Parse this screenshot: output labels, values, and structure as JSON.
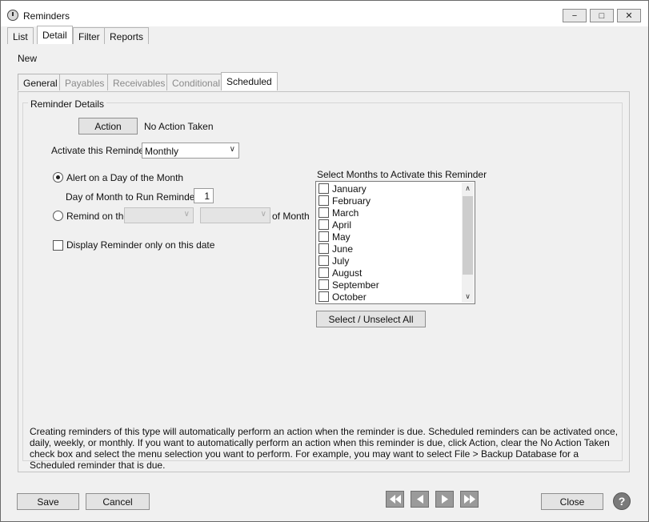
{
  "window": {
    "title": "Reminders",
    "controls": [
      "minimize-icon",
      "maximize-icon",
      "close-icon"
    ]
  },
  "main_tabs": [
    {
      "label": "List"
    },
    {
      "label": "Detail",
      "active": true
    },
    {
      "label": "Filter"
    },
    {
      "label": "Reports"
    }
  ],
  "mode_label": "New",
  "sub_tabs": [
    {
      "label": "General",
      "enabled": true
    },
    {
      "label": "Payables",
      "enabled": false
    },
    {
      "label": "Receivables",
      "enabled": false
    },
    {
      "label": "Conditional",
      "enabled": false
    },
    {
      "label": "Scheduled",
      "enabled": true,
      "active": true
    }
  ],
  "details": {
    "group_label": "Reminder Details",
    "action_button": "Action",
    "action_status": "No Action Taken",
    "activate_label": "Activate this Reminder",
    "activate_value": "Monthly",
    "alert_day_label": "Alert on a Day of the Month",
    "alert_day_selected": true,
    "day_label": "Day of Month to Run Reminder",
    "day_value": "1",
    "remind_on_label": "Remind on the",
    "remind_on_selected": false,
    "of_month_label": "of Month",
    "display_only_label": "Display Reminder only on this date",
    "display_only_checked": false
  },
  "months": {
    "label": "Select Months to Activate this Reminder",
    "items": [
      {
        "label": "January",
        "checked": false
      },
      {
        "label": "February",
        "checked": false
      },
      {
        "label": "March",
        "checked": false
      },
      {
        "label": "April",
        "checked": false
      },
      {
        "label": "May",
        "checked": false
      },
      {
        "label": "June",
        "checked": false
      },
      {
        "label": "July",
        "checked": false
      },
      {
        "label": "August",
        "checked": false
      },
      {
        "label": "September",
        "checked": false
      },
      {
        "label": "October",
        "checked": false
      }
    ],
    "select_all_button": "Select / Unselect All"
  },
  "description": "Creating reminders of this type will automatically perform an action when the reminder is due. Scheduled reminders can be activated once, daily, weekly, or monthly. If you want to automatically perform an action when this reminder is due, click Action, clear the No Action Taken check box and select the menu selection you want to perform. For example, you may want to select File > Backup Database for a Scheduled reminder that is due.",
  "footer": {
    "save": "Save",
    "cancel": "Cancel",
    "close": "Close",
    "help": "?",
    "nav_icons": [
      "first-record-icon",
      "previous-record-icon",
      "next-record-icon",
      "last-record-icon"
    ]
  }
}
